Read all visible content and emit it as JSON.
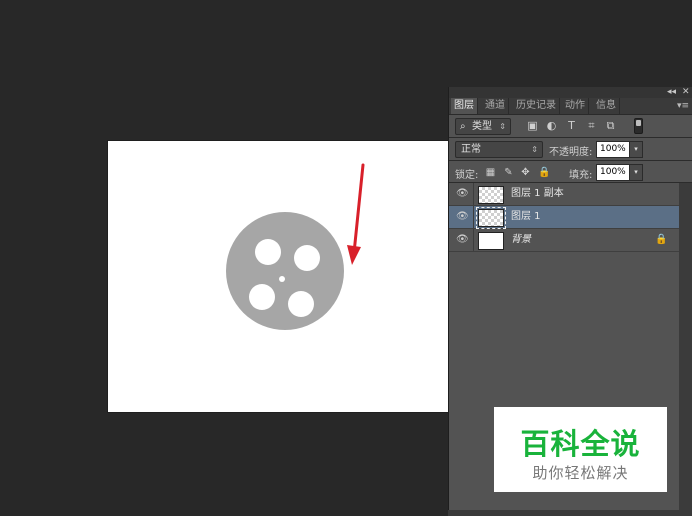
{
  "panel": {
    "topbar": {
      "collapse_glyph": "◂◂",
      "close_glyph": "✕"
    },
    "tabs": [
      {
        "label": "图层",
        "active": true
      },
      {
        "label": "通道",
        "active": false
      },
      {
        "label": "历史记录",
        "active": false
      },
      {
        "label": "动作",
        "active": false
      },
      {
        "label": "信息",
        "active": false
      }
    ],
    "tabs_menu_glyph": "▾≡",
    "filter": {
      "search_glyph": "⌕",
      "label": "类型",
      "spinner_glyph": "⇕",
      "icons": [
        "image-filter-icon",
        "adjustment-filter-icon",
        "type-filter-icon",
        "shape-filter-icon",
        "smart-object-filter-icon"
      ],
      "icon_glyphs": [
        "▣",
        "◐",
        "T",
        "⌗",
        "⧉"
      ]
    },
    "blend": {
      "mode": "正常",
      "spinner_glyph": "⇕",
      "opacity_label": "不透明度:",
      "opacity_value": "100%",
      "stepper_glyph": "▾"
    },
    "lock": {
      "label": "锁定:",
      "icons": [
        "lock-transparent-icon",
        "lock-paint-icon",
        "lock-move-icon",
        "lock-all-icon"
      ],
      "icon_glyphs": [
        "▦",
        "✎",
        "✥",
        "🔒"
      ],
      "fill_label": "填充:",
      "fill_value": "100%",
      "stepper_glyph": "▾"
    },
    "layers": [
      {
        "name": "图层 1 副本",
        "selected": false,
        "thumb": "transparent",
        "locked": false
      },
      {
        "name": "图层 1",
        "selected": true,
        "thumb": "transparent",
        "locked": false
      },
      {
        "name": "背景",
        "selected": false,
        "thumb": "white",
        "locked": true,
        "italic": true
      }
    ],
    "eye_glyph": "👁",
    "lock_glyph": "🔒"
  },
  "watermark": {
    "title": "百科全说",
    "subtitle": "助你轻松解决"
  },
  "colors": {
    "workspace": "#282828",
    "panel": "#535353",
    "selected_layer": "#5b6f86",
    "reel": "#a6a6a6",
    "arrow": "#d8202a",
    "watermark_green": "#19b33b"
  }
}
